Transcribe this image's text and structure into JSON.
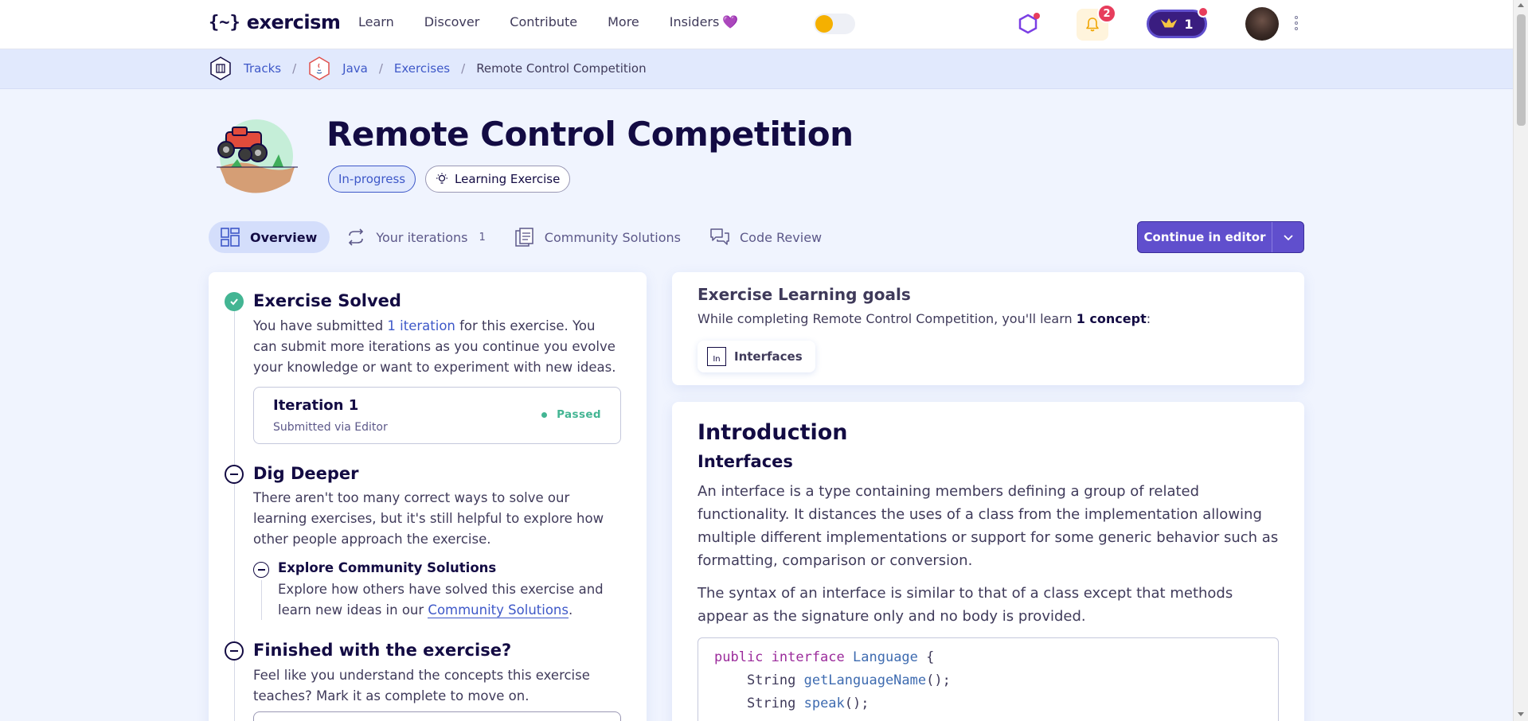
{
  "brand": {
    "logo_mark": "{~}",
    "logo_text": "exercism"
  },
  "nav": {
    "links": [
      "Learn",
      "Discover",
      "Contribute",
      "More",
      "Insiders"
    ],
    "insiders_heart": "💜",
    "notifications_count": "2",
    "reputation": "1"
  },
  "breadcrumb": {
    "tracks": "Tracks",
    "track": "Java",
    "exercises": "Exercises",
    "current": "Remote Control Competition",
    "separator": "/"
  },
  "exercise": {
    "title": "Remote Control Competition",
    "status_tag": "In-progress",
    "type_tag": "Learning Exercise"
  },
  "tabs": [
    {
      "label": "Overview",
      "icon": "overview-icon"
    },
    {
      "label": "Your iterations",
      "count": "1",
      "icon": "iterations-icon"
    },
    {
      "label": "Community Solutions",
      "icon": "community-solutions-icon"
    },
    {
      "label": "Code Review",
      "icon": "code-review-icon"
    }
  ],
  "continue_button": {
    "label": "Continue in editor"
  },
  "steps": {
    "solved": {
      "title": "Exercise Solved",
      "text_before": "You have submitted ",
      "link": "1 iteration",
      "text_after": " for this exercise. You can submit more iterations as you continue you evolve your knowledge or want to experiment with new ideas."
    },
    "iteration": {
      "title": "Iteration 1",
      "subtitle": "Submitted via Editor",
      "status": "Passed"
    },
    "dig": {
      "title": "Dig Deeper",
      "text": "There aren't too many correct ways to solve our learning exercises, but it's still helpful to explore how other people approach the exercise."
    },
    "explore": {
      "title": "Explore Community Solutions",
      "text_before": "Explore how others have solved this exercise and learn new ideas in our ",
      "link": "Community Solutions",
      "text_after": "."
    },
    "finished": {
      "title": "Finished with the exercise?",
      "text": "Feel like you understand the concepts this exercise teaches? Mark it as complete to move on."
    }
  },
  "goals": {
    "title": "Exercise Learning goals",
    "text_before": "While completing Remote Control Competition, you'll learn ",
    "count": "1 concept",
    "text_after": ":",
    "concept": "Interfaces",
    "concept_icon_text": "In"
  },
  "intro": {
    "h1": "Introduction",
    "h2": "Interfaces",
    "p1": "An interface is a type containing members defining a group of related functionality. It distances the uses of a class from the implementation allowing multiple different implementations or support for some generic behavior such as formatting, comparison or conversion.",
    "p2": "The syntax of an interface is similar to that of a class except that methods appear as the signature only and no body is provided.",
    "code": {
      "l1_kw": "public interface",
      "l1_type": "Language",
      "l1_rest": " {",
      "l2_type": "    String ",
      "l2_fn": "getLanguageName",
      "l2_rest": "();",
      "l3_type": "    String ",
      "l3_fn": "speak",
      "l3_rest": "();"
    }
  },
  "colors": {
    "accent": "#604fcd",
    "link": "#3e58c8",
    "success": "#43b593",
    "danger": "#e73d5c",
    "heading": "#130b43"
  }
}
